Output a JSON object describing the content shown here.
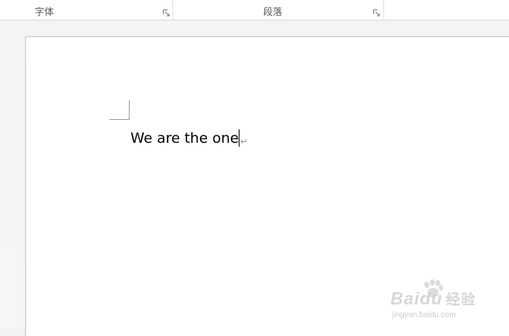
{
  "ribbon": {
    "font_group_label": "字体",
    "paragraph_group_label": "段落",
    "launcher_icon": "dialog-launcher-icon"
  },
  "document": {
    "text": "We are the one",
    "paragraph_mark": "↵"
  },
  "watermark": {
    "brand": "Baidu",
    "brand_cn": "经验",
    "url": "jingyan.baidu.com"
  },
  "colors": {
    "ribbon_bg": "#ffffff",
    "doc_bg": "#f3f3f3",
    "page_bg": "#ffffff",
    "label_text": "#555555"
  }
}
